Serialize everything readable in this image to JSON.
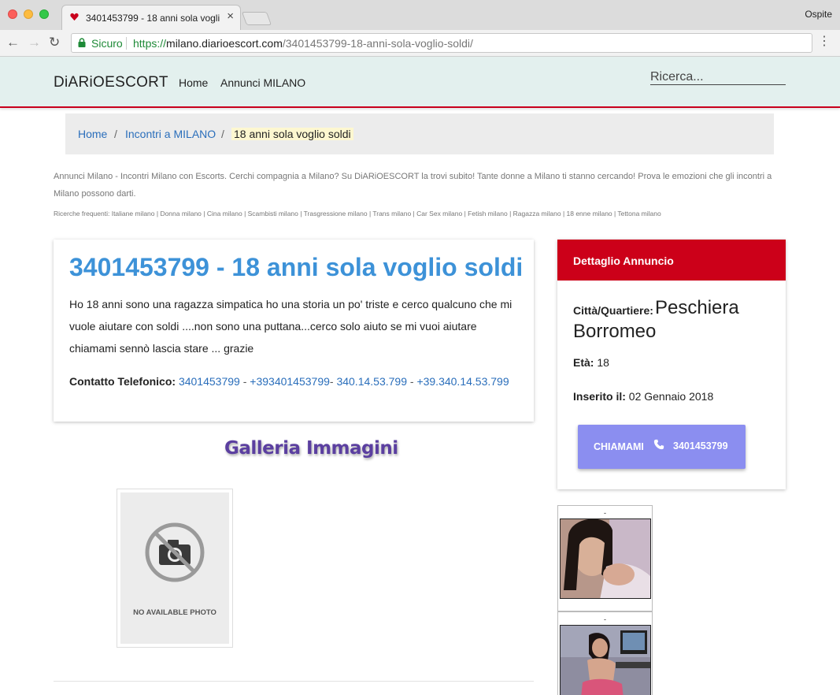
{
  "browser": {
    "tab_title": "3401453799 - 18 anni sola voglio soldi",
    "tab_close": "×",
    "profile": "Ospite",
    "secure_label": "Sicuro",
    "url_scheme": "https://",
    "url_host": "milano.diarioescort.com",
    "url_path": "/3401453799-18-anni-sola-voglio-soldi/",
    "back_glyph": "←",
    "forward_glyph": "→",
    "reload_glyph": "↻",
    "menu_glyph": "⋮"
  },
  "site_nav": {
    "brand": "DiARiOESCORT",
    "links": [
      "Home",
      "Annunci MILANO"
    ],
    "search_placeholder": "Ricerca..."
  },
  "breadcrumb": {
    "items": [
      "Home",
      "Incontri a MILANO"
    ],
    "separator": "/",
    "current": "18 anni sola voglio soldi"
  },
  "intro": "Annunci Milano - Incontri Milano con Escorts. Cerchi compagnia a Milano? Su DiARiOESCORT la trovi subito! Tante donne a Milano ti stanno cercando! Prova le emozioni che gli incontri a Milano possono darti.",
  "frequent_searches": "Ricerche frequenti: Italiane milano | Donna milano | Cina milano | Scambisti milano | Trasgressione milano | Trans milano | Car Sex milano | Fetish milano | Ragazza milano | 18 enne milano | Tettona milano",
  "listing": {
    "title": "3401453799 - 18 anni sola voglio soldi",
    "description": "Ho 18 anni sono una ragazza simpatica ho una storia un po' triste e cerco qualcuno che mi vuole aiutare con soldi ....non sono una puttana...cerco solo aiuto se mi vuoi aiutare chiamami sennò lascia stare ... grazie",
    "contact_label": "Contatto Telefonico:",
    "phones": [
      "3401453799",
      "+393401453799",
      "340.14.53.799",
      "+39.340.14.53.799"
    ],
    "separators": [
      " - ",
      "- ",
      " - "
    ]
  },
  "gallery": {
    "title": "Galleria Immagini",
    "no_photo_text": "NO AVAILABLE PHOTO"
  },
  "detail": {
    "header": "Dettaglio Annuncio",
    "city_label": "Città/Quartiere:",
    "city_value": "Peschiera Borromeo",
    "age_label": "Età:",
    "age_value": "18",
    "inserted_label": "Inserito il:",
    "inserted_value": "02 Gennaio 2018",
    "call_label": "CHIAMAMI",
    "call_number": "3401453799"
  },
  "thumbnails": [
    {
      "caption": "-"
    },
    {
      "caption": "-"
    }
  ],
  "colors": {
    "accent_red": "#cc0019",
    "link_blue": "#2a6ebb",
    "title_blue": "#3d92d8",
    "call_button": "#8b8ef0",
    "nav_bg": "#e3f0ee",
    "gallery_title": "#5b3fa0"
  }
}
